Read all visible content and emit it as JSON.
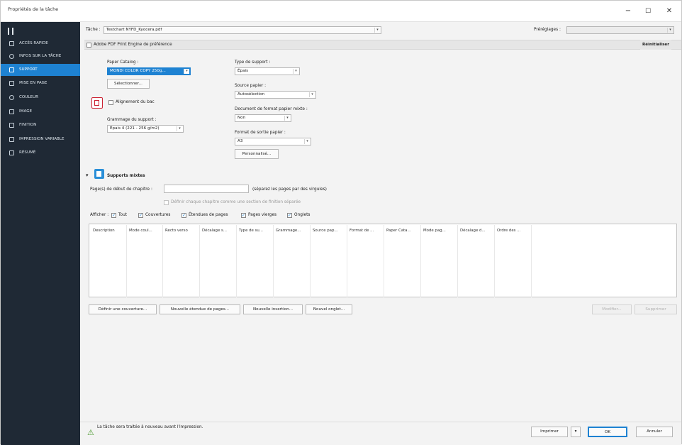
{
  "window": {
    "title": "Propriétés de la tâche",
    "controls": [
      "−",
      "☐",
      "✕"
    ]
  },
  "sidebar": {
    "items": [
      {
        "label": "ACCÈS RAPIDE",
        "icon": "star-icon"
      },
      {
        "label": "INFOS SUR LA TÂCHE",
        "icon": "info-icon"
      },
      {
        "label": "SUPPORT",
        "icon": "document-icon"
      },
      {
        "label": "MISE EN PAGE",
        "icon": "layout-icon"
      },
      {
        "label": "COULEUR",
        "icon": "palette-icon"
      },
      {
        "label": "IMAGE",
        "icon": "image-icon"
      },
      {
        "label": "FINITION",
        "icon": "finishing-icon"
      },
      {
        "label": "IMPRESSION VARIABLE",
        "icon": "variable-print-icon"
      },
      {
        "label": "RÉSUMÉ",
        "icon": "summary-icon"
      }
    ],
    "selected": "SUPPORT"
  },
  "header": {
    "task_label": "Tâche :",
    "task_value": "Testchart NYFD_Kyocera.pdf",
    "presets_label": "Préréglages :",
    "presets_value": ""
  },
  "engine_bar": {
    "checkbox_label": "Adobe PDF Print Engine de préférence",
    "reset_button": "Réinitialiser"
  },
  "paper": {
    "catalog_label": "Paper Catalog :",
    "catalog_value": "MONDI COLOR COPY 250g...",
    "select_button": "Sélectionner...",
    "tray_align_label": "Alignement du bac",
    "weight_label": "Grammage du support :",
    "weight_value": "Épais 4 (221 - 256 g/m2)"
  },
  "media": {
    "type_label": "Type de support :",
    "type_value": "Épais",
    "source_label": "Source papier :",
    "source_value": "Autosélection",
    "mixed_doc_label": "Document de format papier mixte :",
    "mixed_doc_value": "Non",
    "output_label": "Format de sortie papier :",
    "output_value": "A3",
    "custom_button": "Personnalisé..."
  },
  "mixed_media": {
    "section_title": "Supports mixtes",
    "chapter_label": "Page(s) de début de chapitre :",
    "chapter_hint": "(séparez les pages par des virgules)",
    "chapter_checkbox": "Définir chaque chapitre comme une section de finition séparée",
    "show_label": "Afficher :",
    "filters": [
      "Tout",
      "Couvertures",
      "Étendues de pages",
      "Pages vierges",
      "Onglets"
    ],
    "columns": [
      "Description",
      "Mode coul...",
      "Recto verso",
      "Décalage s...",
      "Type de su...",
      "Grammage...",
      "Source pap...",
      "Format de ...",
      "Paper Cata...",
      "Mode pag...",
      "Décalage d...",
      "Ordre des ..."
    ],
    "buttons": [
      "Définir une couverture...",
      "Nouvelle étendue de pages...",
      "Nouvelle insertion...",
      "Nouvel onglet..."
    ],
    "edit_button": "Modifier...",
    "delete_button": "Supprimer"
  },
  "status": {
    "message": "La tâche sera traitée à nouveau avant l'impression.",
    "print_button": "Imprimer",
    "print_dropdown": "▾",
    "ok_button": "OK",
    "cancel_button": "Annuler"
  }
}
